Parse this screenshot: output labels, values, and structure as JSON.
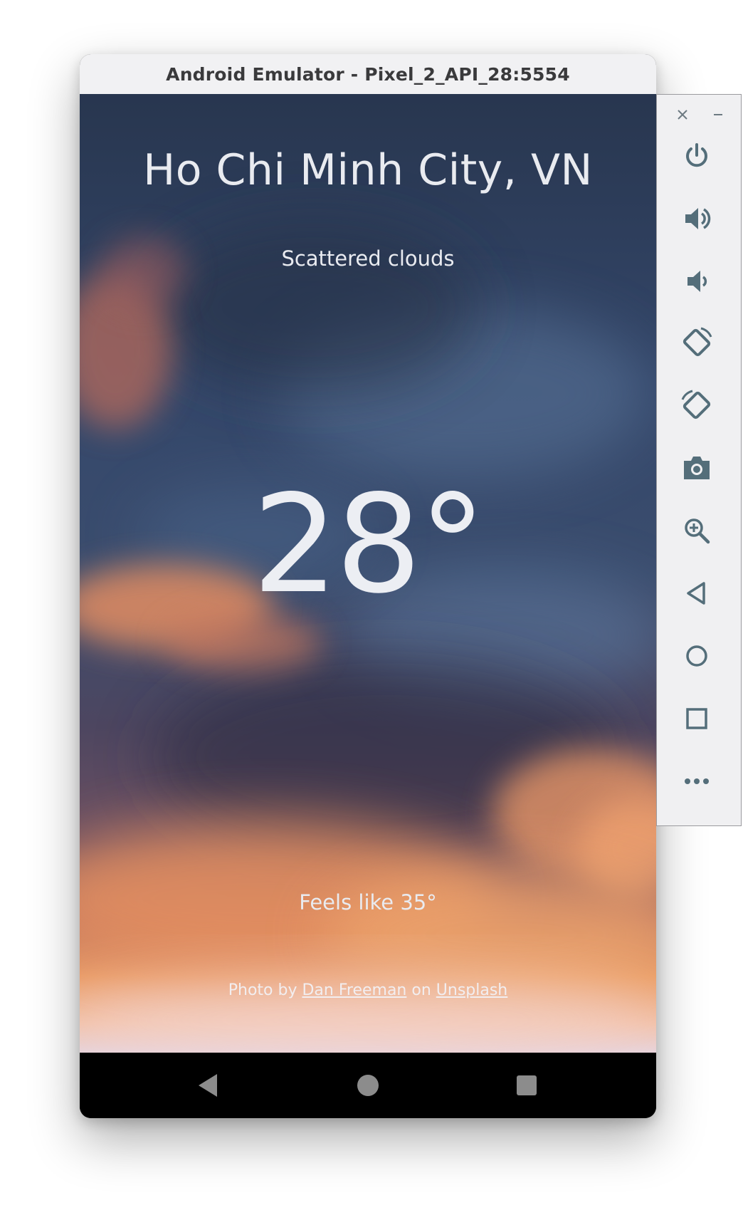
{
  "window": {
    "title": "Android Emulator - Pixel_2_API_28:5554"
  },
  "weather": {
    "city": "Ho Chi Minh City, VN",
    "condition": "Scattered clouds",
    "temperature": "28°",
    "feels_like": "Feels like 35°"
  },
  "credit": {
    "prefix": "Photo by",
    "author": "Dan Freeman",
    "middle": "on",
    "source": "Unsplash"
  },
  "nav": {
    "back_icon": "back-triangle-icon",
    "home_icon": "home-circle-icon",
    "recents_icon": "recents-square-icon"
  },
  "toolbar": {
    "icons": [
      "close-icon",
      "minimize-icon",
      "power-icon",
      "volume-up-icon",
      "volume-down-icon",
      "rotate-left-icon",
      "rotate-right-icon",
      "camera-icon",
      "zoom-icon",
      "back-icon",
      "home-icon",
      "overview-icon",
      "more-icon"
    ],
    "icon_color": "#546e7a"
  },
  "colors": {
    "sky_top": "#2b3a55",
    "cloud_orange": "#f0a06a",
    "text": "#e9ebf0",
    "toolbar_bg": "#f0f0f2"
  }
}
